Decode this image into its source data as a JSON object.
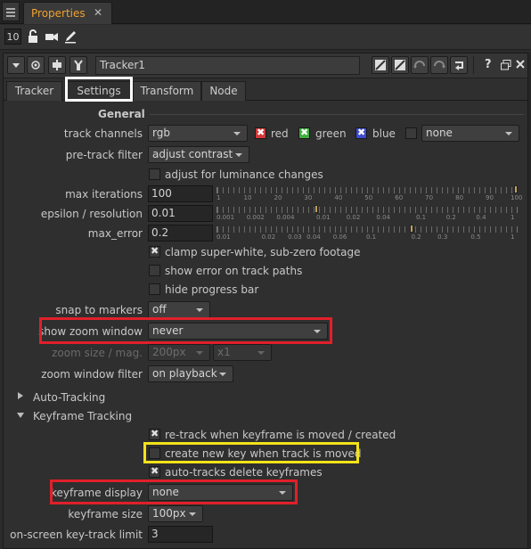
{
  "panel": {
    "tab_label": "Properties",
    "close_glyph": "✕"
  },
  "toolbar": {
    "node_count": "10"
  },
  "node": {
    "name": "Tracker1",
    "tabs": [
      "Tracker",
      "Settings",
      "Transform",
      "Node"
    ],
    "active_tab": "Settings",
    "help_glyph": "?"
  },
  "general": {
    "title": "General",
    "track_channels": {
      "label": "track channels",
      "value": "rgb",
      "red": "red",
      "green": "green",
      "blue": "blue",
      "extra": "none"
    },
    "pre_track_filter": {
      "label": "pre-track filter",
      "value": "adjust contrast"
    },
    "adjust_luminance": {
      "label": "adjust for luminance changes"
    },
    "max_iterations": {
      "label": "max iterations",
      "value": "100",
      "ticks": [
        "1",
        "10",
        "20",
        "30",
        "40",
        "50",
        "60",
        "70",
        "80",
        "90",
        "100"
      ],
      "level": 100
    },
    "epsilon": {
      "label": "epsilon / resolution",
      "value": "0.01",
      "ticks": [
        "0.001",
        "0.002",
        "0.004",
        "0.01",
        "0.02",
        "0.04",
        "0.1",
        "0.2",
        "0.4",
        "1"
      ],
      "level": 0.01
    },
    "max_error": {
      "label": "max_error",
      "value": "0.2",
      "ticks": [
        "0.01",
        "0.02",
        "0.03",
        "0.04",
        "0.06",
        "0.1",
        "0.2",
        "0.3",
        "0.5",
        "1"
      ],
      "level": 0.2
    },
    "clamp": {
      "label": "clamp super-white, sub-zero footage"
    },
    "show_error": {
      "label": "show error on track paths"
    },
    "hide_progress": {
      "label": "hide progress bar"
    },
    "snap_to_markers": {
      "label": "snap to markers",
      "value": "off"
    },
    "show_zoom_window": {
      "label": "show zoom window",
      "value": "never"
    },
    "zoom_size": {
      "label": "zoom size / mag.",
      "value": "200px",
      "mag": "x1"
    },
    "zoom_filter": {
      "label": "zoom window filter",
      "value": "on playback"
    }
  },
  "auto_tracking": {
    "title": "Auto-Tracking"
  },
  "keyframe_tracking": {
    "title": "Keyframe Tracking",
    "retrack": {
      "label": "re-track when keyframe is moved / created"
    },
    "create_new_key": {
      "label": "create new key when track is moved"
    },
    "auto_delete": {
      "label": "auto-tracks delete keyframes"
    },
    "keyframe_display": {
      "label": "keyframe display",
      "value": "none"
    },
    "keyframe_size": {
      "label": "keyframe size",
      "value": "100px"
    },
    "key_track_limit": {
      "label": "on-screen key-track limit",
      "value": "3"
    }
  },
  "colors": {
    "accent_tab": "#f0a030",
    "highlight_red": "#e0202a",
    "highlight_yellow": "#f2e21a",
    "highlight_white": "#ffffff"
  },
  "icons": [
    "grip-icon",
    "lock-icon",
    "camera-icon",
    "pencil-icon",
    "collapse-icon",
    "view-icon",
    "node-icon",
    "settings-icon",
    "undo-icon",
    "redo-icon",
    "revert-icon",
    "help-icon",
    "float-icon",
    "close-icon"
  ]
}
